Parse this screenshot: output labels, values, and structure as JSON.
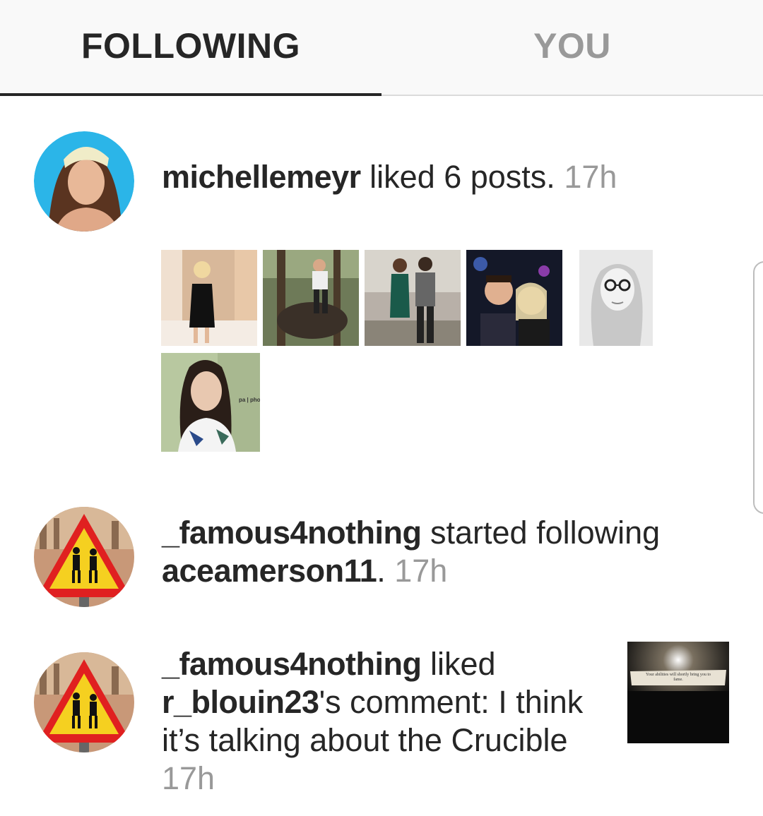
{
  "tabs": {
    "following": "FOLLOWING",
    "you": "YOU"
  },
  "notifications": [
    {
      "user": "michellemeyr",
      "action": " liked 6 posts. ",
      "time": "17h"
    },
    {
      "user": "_famous4nothing",
      "action_line1": " started following",
      "target": "aceamerson11",
      "after_target": ". ",
      "time": "17h"
    },
    {
      "user": "_famous4nothing",
      "action_line1": " liked",
      "target": "r_blouin23",
      "after_target": "'s comment: I think",
      "comment_line2": "it’s talking about the Crucible",
      "time": "17h"
    }
  ],
  "watermarks": {
    "post6": "pa | phot",
    "fortune": "Your abilities will shortly bring you to fame."
  },
  "colors": {
    "active_tab": "#262626",
    "inactive_tab": "#999999",
    "timestamp": "#999999",
    "avatar_ring": "#2bb5e8",
    "warning_sign_red": "#e02020",
    "warning_sign_yellow": "#f5d020"
  },
  "icons": {
    "avatar1": "profile-photo",
    "avatar2": "pedestrian-warning-sign",
    "avatar3": "pedestrian-warning-sign"
  }
}
